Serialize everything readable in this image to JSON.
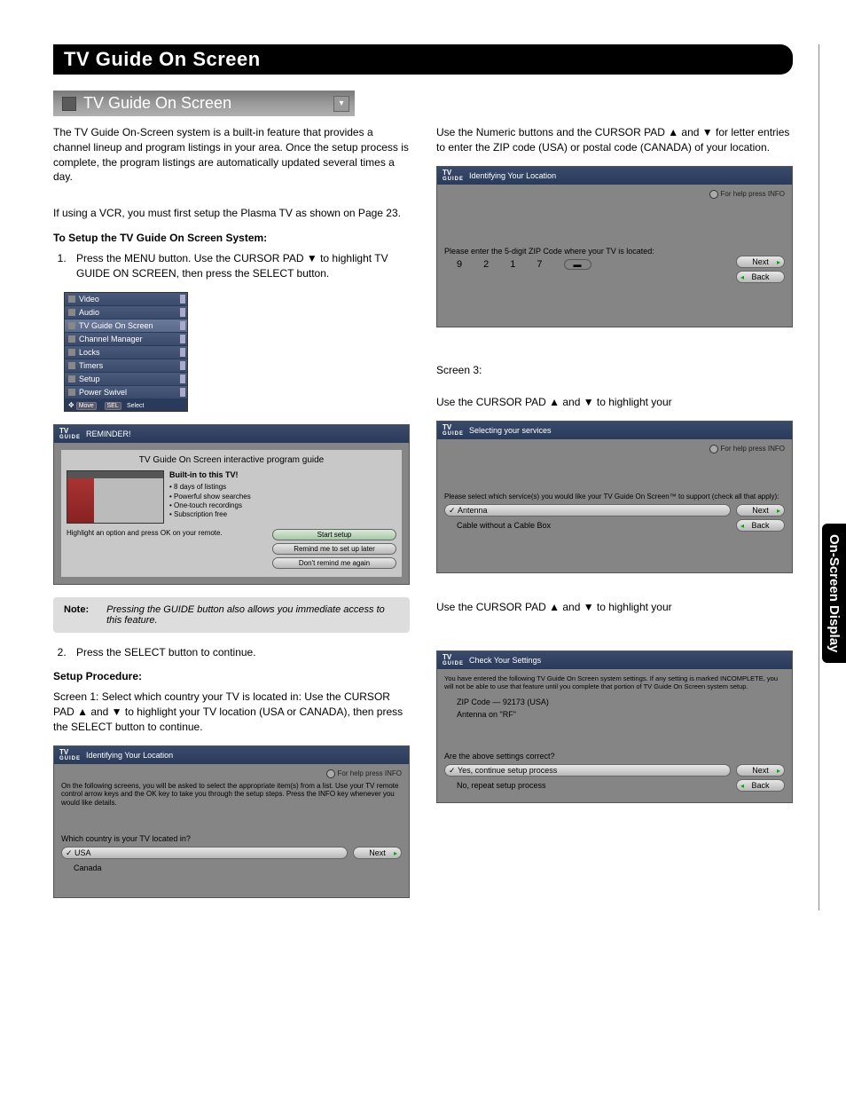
{
  "header": {
    "title": "TV Guide On Screen"
  },
  "section_title": "TV Guide On Screen",
  "side_tab": "On-Screen Display",
  "left": {
    "intro": "The TV Guide On-Screen system is a built-in feature that provides a channel lineup and program listings in your area.  Once the setup process is complete, the program listings are automatically updated several times a day.",
    "vcr_note": "If using a  VCR, you must first setup the Plasma TV as shown on Page 23.",
    "setup_head": "To Setup the TV Guide On Screen System:",
    "step1": "Press the MENU button.  Use the CURSOR PAD ▼ to highlight TV GUIDE ON SCREEN, then press the SELECT button.",
    "menu_items": [
      "Video",
      "Audio",
      "TV Guide On Screen",
      "Channel Manager",
      "Locks",
      "Timers",
      "Setup",
      "Power Swivel"
    ],
    "menu_foot_move": "Move",
    "menu_foot_sel": "SEL",
    "menu_foot_select": "Select",
    "reminder": {
      "top": "REMINDER!",
      "title": "TV Guide On Screen interactive program guide",
      "built_in": "Built-in to this TV!",
      "features": [
        "• 8 days of listings",
        "• Powerful show searches",
        "• One-touch recordings",
        "• Subscription free"
      ],
      "hint": "Highlight an option and press OK on your remote.",
      "btn1": "Start setup",
      "btn2": "Remind me to set up later",
      "btn3": "Don't remind me again"
    },
    "note_label": "Note:",
    "note_text": "Pressing the GUIDE button also allows you immediate access to this feature.",
    "step2": "Press the SELECT button to continue.",
    "proc_head": "Setup Procedure:",
    "screen1": "Screen 1:  Select which country your TV is located in:  Use the CURSOR PAD ▲ and ▼ to highlight your TV location (USA or CANADA), then press the SELECT button to continue.",
    "loc_box": {
      "top": "Identifying Your Location",
      "help": "For help press INFO",
      "text": "On the following screens, you will be asked to select the appropriate item(s) from a list. Use your TV remote control arrow keys and the OK key to take you through the setup steps. Press the INFO key whenever you would like details.",
      "question": "Which country is your TV located in?",
      "opt1": "USA",
      "opt2": "Canada",
      "next": "Next"
    }
  },
  "right": {
    "zip_intro": "Use the Numeric buttons and the CURSOR PAD ▲ and ▼ for letter entries to enter the ZIP code (USA) or postal code (CANADA) of your location.",
    "zip_box": {
      "top": "Identifying Your Location",
      "help": "For help press INFO",
      "question": "Please enter the 5-digit ZIP Code where your TV is located:",
      "digits": [
        "9",
        "2",
        "1",
        "7"
      ],
      "next": "Next",
      "back": "Back"
    },
    "screen3_label": "Screen 3:",
    "cursor_hint1": "Use the CURSOR PAD ▲ and ▼ to highlight your",
    "svc_box": {
      "top": "Selecting your services",
      "help": "For help press INFO",
      "question": "Please select which service(s) you would like your TV Guide On Screen™ to support (check all that apply):",
      "opt1": "Antenna",
      "opt2": "Cable without a Cable Box",
      "next": "Next",
      "back": "Back"
    },
    "cursor_hint2": "Use the CURSOR PAD ▲ and ▼ to highlight your",
    "chk_box": {
      "top": "Check Your Settings",
      "text": "You have entered the following TV Guide On Screen system settings. If any setting is marked INCOMPLETE, you will not be able to use that feature until you complete that portion of TV Guide On Screen system setup.",
      "line1": "ZIP Code — 92173 (USA)",
      "line2": "Antenna on \"RF\"",
      "question": "Are the above settings correct?",
      "opt1": "Yes, continue setup process",
      "opt2": "No, repeat setup process",
      "next": "Next",
      "back": "Back"
    }
  }
}
